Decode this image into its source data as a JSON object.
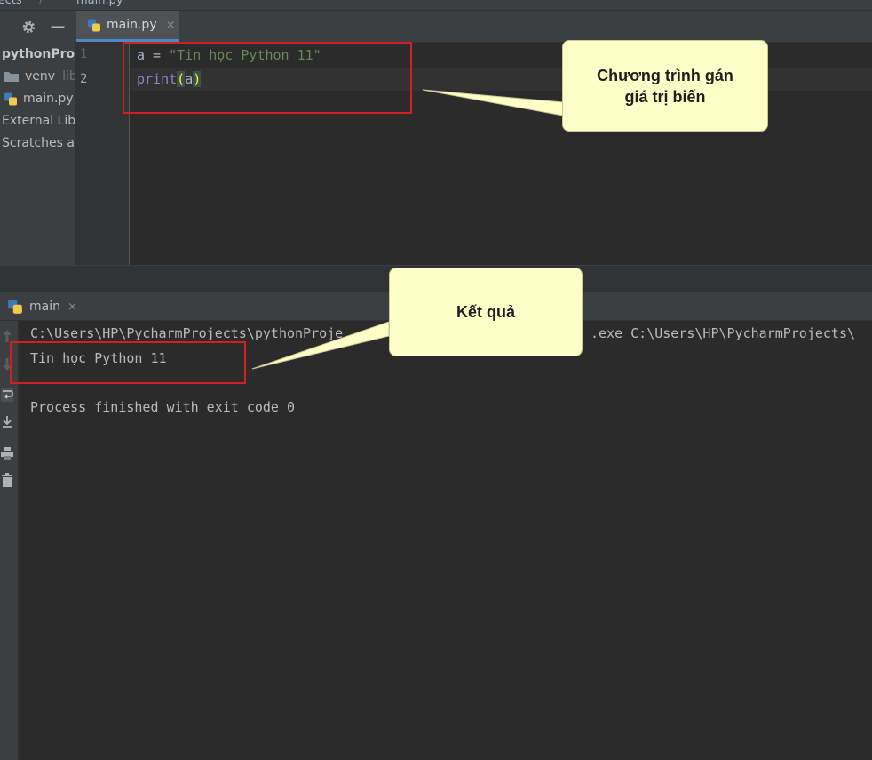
{
  "breadcrumb": {
    "project": "jects",
    "separator": "/",
    "file": "main.py"
  },
  "project_panel": {
    "root_label": "pythonProject",
    "items": [
      {
        "label": "venv",
        "suffix": "library root"
      },
      {
        "label": "main.py"
      },
      {
        "label": "External Libraries"
      },
      {
        "label": "Scratches and Consoles"
      }
    ]
  },
  "editor": {
    "tab_label": "main.py",
    "tab_close": "×",
    "line_numbers": [
      "1",
      "2"
    ],
    "line1": {
      "var": "a",
      "op": " = ",
      "string": "\"Tin học Python 11\""
    },
    "line2": {
      "fn": "print",
      "open": "(",
      "arg": "a",
      "close": ")"
    }
  },
  "run_panel": {
    "tab_label": "main",
    "tab_close": "×",
    "lines": {
      "command_start": "C:\\Users\\HP\\PycharmProjects\\pythonProje",
      "command_end": ".exe C:\\Users\\HP\\PycharmProjects\\",
      "output": "Tin học Python 11",
      "exit": "Process finished with exit code 0"
    }
  },
  "callouts": {
    "program": [
      "Chương trình gán",
      "giá trị biến"
    ],
    "result": "Kết quả"
  },
  "colors": {
    "accent": "#4a88c7",
    "annotation_red": "#d21f1f",
    "callout_fill": "#fefec8",
    "string": "#6a8759",
    "builtin": "#8888c6"
  }
}
